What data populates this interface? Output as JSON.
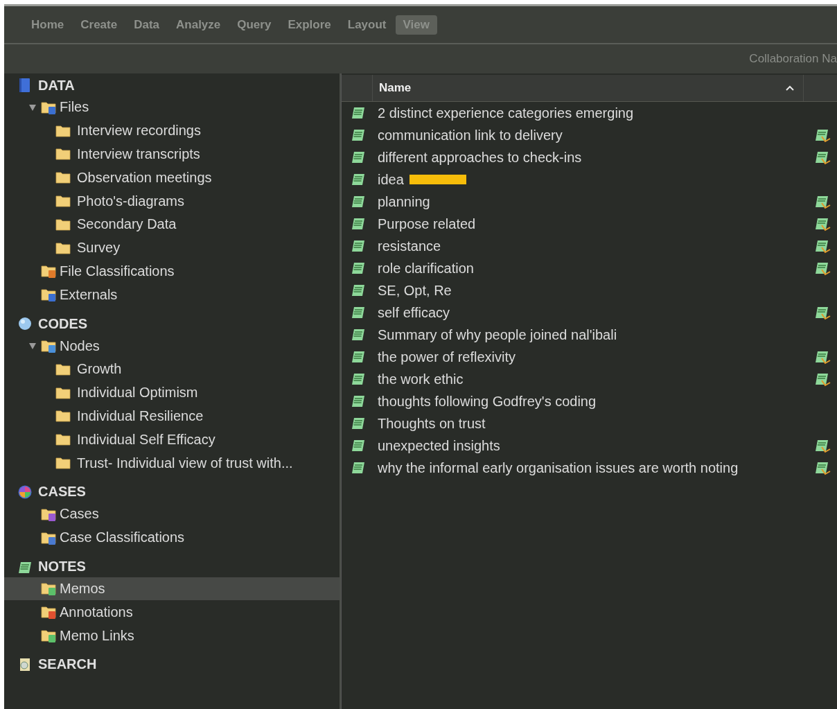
{
  "menu": [
    {
      "label": "Home",
      "selected": false
    },
    {
      "label": "Create",
      "selected": false
    },
    {
      "label": "Data",
      "selected": false
    },
    {
      "label": "Analyze",
      "selected": false
    },
    {
      "label": "Query",
      "selected": false
    },
    {
      "label": "Explore",
      "selected": false
    },
    {
      "label": "Layout",
      "selected": false
    },
    {
      "label": "View",
      "selected": true
    }
  ],
  "toolbar": {
    "text": "Collaboration Na"
  },
  "sidebar": [
    {
      "title": "DATA",
      "kind": "data",
      "items": [
        {
          "label": "Files",
          "kind": "files",
          "selected": false,
          "expanded": true,
          "children": [
            {
              "label": "Interview recordings",
              "kind": "folder",
              "selected": false
            },
            {
              "label": "Interview transcripts",
              "kind": "folder",
              "selected": false
            },
            {
              "label": "Observation meetings",
              "kind": "folder",
              "selected": false
            },
            {
              "label": "Photo's-diagrams",
              "kind": "folder",
              "selected": false
            },
            {
              "label": "Secondary Data",
              "kind": "folder",
              "selected": false
            },
            {
              "label": "Survey",
              "kind": "folder",
              "selected": false
            }
          ]
        },
        {
          "label": "File Classifications",
          "kind": "classifications",
          "selected": false
        },
        {
          "label": "Externals",
          "kind": "externals",
          "selected": false
        }
      ]
    },
    {
      "title": "CODES",
      "kind": "codes",
      "items": [
        {
          "label": "Nodes",
          "kind": "nodes",
          "selected": false,
          "expanded": true,
          "children": [
            {
              "label": "Growth",
              "kind": "folder",
              "selected": false
            },
            {
              "label": "Individual Optimism",
              "kind": "folder",
              "selected": false
            },
            {
              "label": "Individual Resilience",
              "kind": "folder",
              "selected": false
            },
            {
              "label": "Individual Self Efficacy",
              "kind": "folder",
              "selected": false
            },
            {
              "label": "Trust- Individual view of trust with...",
              "kind": "folder",
              "selected": false
            }
          ]
        }
      ]
    },
    {
      "title": "CASES",
      "kind": "cases",
      "items": [
        {
          "label": "Cases",
          "kind": "cases",
          "selected": false
        },
        {
          "label": "Case Classifications",
          "kind": "case-classifications",
          "selected": false
        }
      ]
    },
    {
      "title": "NOTES",
      "kind": "notes",
      "items": [
        {
          "label": "Memos",
          "kind": "memos",
          "selected": true
        },
        {
          "label": "Annotations",
          "kind": "annotations",
          "selected": false
        },
        {
          "label": "Memo Links",
          "kind": "memo-links",
          "selected": false
        }
      ]
    },
    {
      "title": "SEARCH",
      "kind": "search"
    }
  ],
  "table": {
    "columns": [
      {
        "label": "Name"
      }
    ],
    "rows": [
      {
        "name": "2 distinct experience categories emerging",
        "linked": false,
        "redacted": false
      },
      {
        "name": "communication link to delivery",
        "linked": true,
        "redacted": false
      },
      {
        "name": "different approaches to check-ins",
        "linked": true,
        "redacted": false
      },
      {
        "name": "idea",
        "linked": false,
        "redacted": true
      },
      {
        "name": "planning",
        "linked": true,
        "redacted": false
      },
      {
        "name": "Purpose related",
        "linked": true,
        "redacted": false
      },
      {
        "name": "resistance",
        "linked": true,
        "redacted": false
      },
      {
        "name": "role clarification",
        "linked": true,
        "redacted": false
      },
      {
        "name": "SE, Opt, Re",
        "linked": false,
        "redacted": false
      },
      {
        "name": "self efficacy",
        "linked": true,
        "redacted": false
      },
      {
        "name": "Summary of why people joined nal'ibali",
        "linked": false,
        "redacted": false
      },
      {
        "name": "the power of reflexivity",
        "linked": true,
        "redacted": false
      },
      {
        "name": "the work ethic",
        "linked": true,
        "redacted": false
      },
      {
        "name": "thoughts following Godfrey's coding",
        "linked": false,
        "redacted": false
      },
      {
        "name": "Thoughts on trust",
        "linked": false,
        "redacted": false
      },
      {
        "name": "unexpected insights",
        "linked": true,
        "redacted": false
      },
      {
        "name": "why the informal early organisation issues are worth noting",
        "linked": true,
        "redacted": false
      }
    ]
  }
}
